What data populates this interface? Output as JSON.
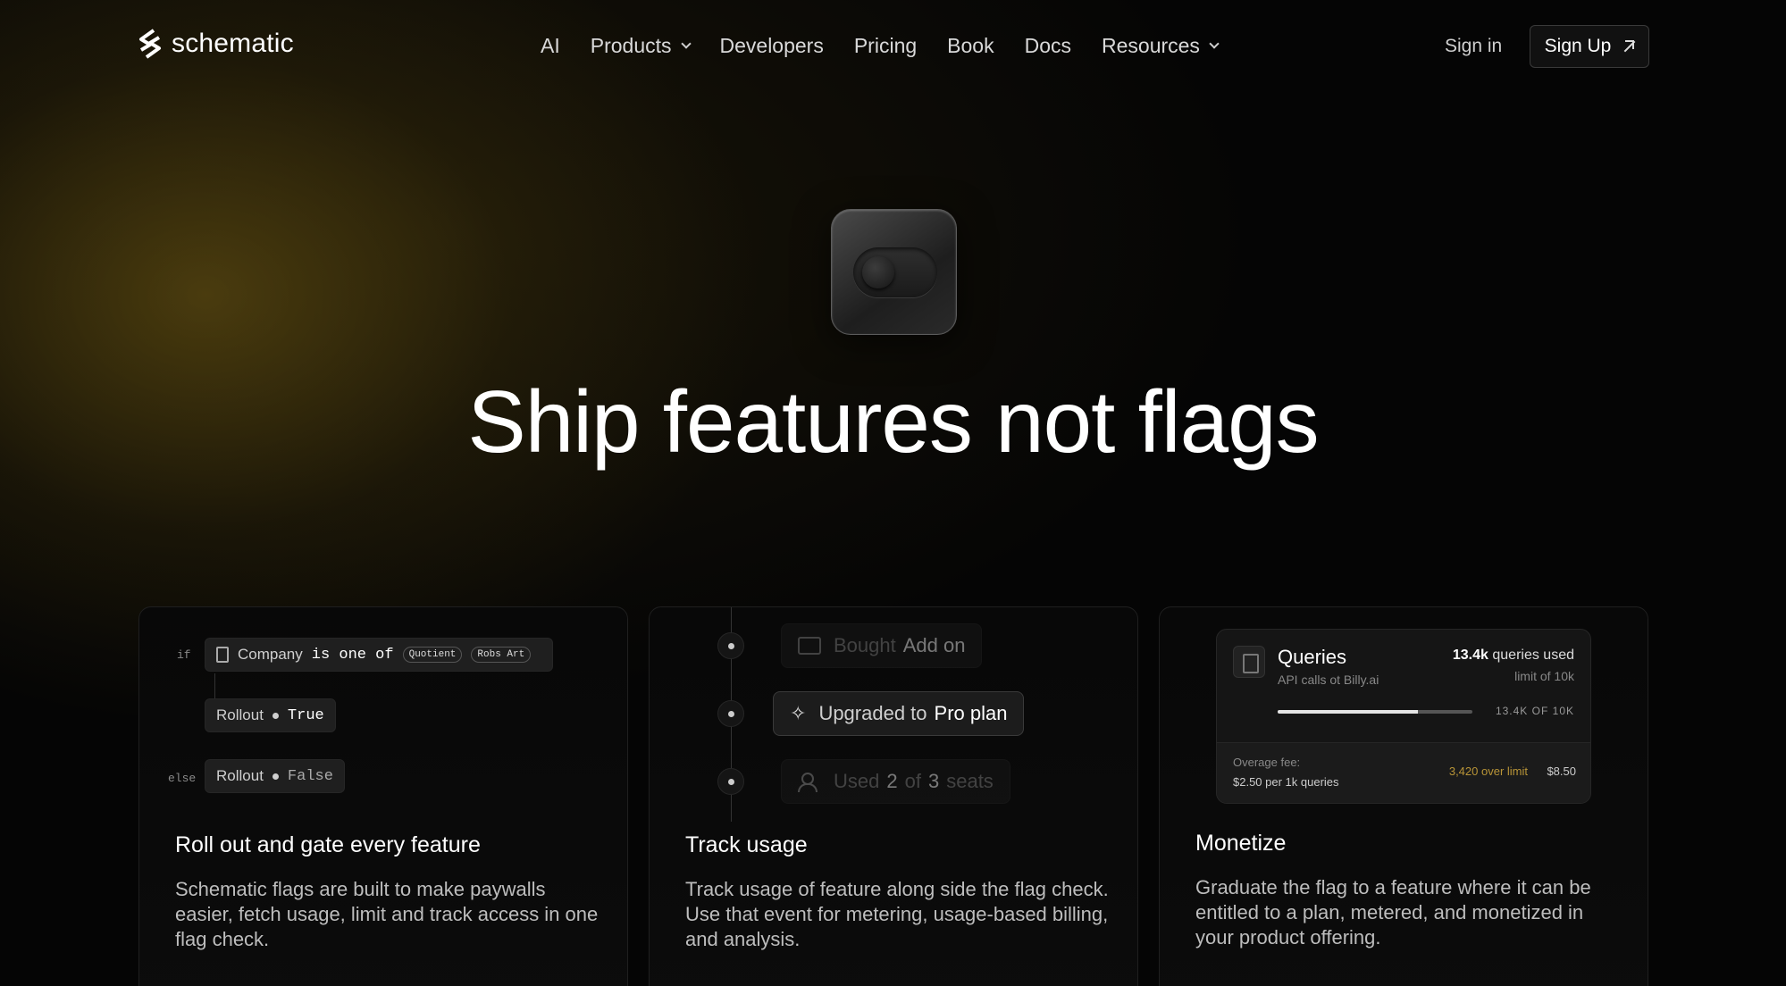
{
  "brand": {
    "name": "schematic"
  },
  "nav": {
    "links": [
      {
        "label": "AI",
        "dropdown": false
      },
      {
        "label": "Products",
        "dropdown": true
      },
      {
        "label": "Developers",
        "dropdown": false
      },
      {
        "label": "Pricing",
        "dropdown": false
      },
      {
        "label": "Book",
        "dropdown": false
      },
      {
        "label": "Docs",
        "dropdown": false
      },
      {
        "label": "Resources",
        "dropdown": true
      }
    ],
    "signin": "Sign in",
    "signup": "Sign Up"
  },
  "hero": {
    "title": "Ship features not flags",
    "icon": "toggle-icon"
  },
  "cards": [
    {
      "title": "Roll out and gate every feature",
      "desc": "Schematic flags are built to make paywalls easier, fetch usage, limit and track access in one flag check.",
      "rule": {
        "if_kw": "if",
        "else_kw": "else",
        "subject": "Company",
        "operator": "is one of",
        "tags": [
          "Quotient",
          "Robs Art"
        ],
        "rollout_label": "Rollout",
        "true_value": "True",
        "false_value": "False"
      }
    },
    {
      "title": "Track usage",
      "desc": "Track usage of feature along side the flag check. Use that event for metering, usage-based billing, and analysis.",
      "events": [
        {
          "prefix": "Bought",
          "highlight": "Add on",
          "suffix": ""
        },
        {
          "prefix": "Upgraded to",
          "highlight": "Pro plan",
          "suffix": ""
        },
        {
          "prefix": "Used",
          "highlight": "2",
          "mid": "of",
          "highlight2": "3",
          "suffix": "seats"
        }
      ]
    },
    {
      "title": "Monetize",
      "desc": "Graduate the flag to a feature where it can be entitled to a plan, metered, and monetized in your product offering.",
      "queries": {
        "title": "Queries",
        "subtitle": "API calls ot Billy.ai",
        "used_value": "13.4k",
        "used_label": "queries used",
        "limit": "limit of 10k",
        "bar_label": "13.4K OF 10K",
        "bar_fill": 0.72,
        "overage_label": "Overage fee:",
        "overage_rate": "$2.50 per 1k queries",
        "over_limit": "3,420 over limit",
        "fee": "$8.50"
      }
    }
  ],
  "colors": {
    "accent_gold": "#b89437",
    "background": "#050505"
  }
}
